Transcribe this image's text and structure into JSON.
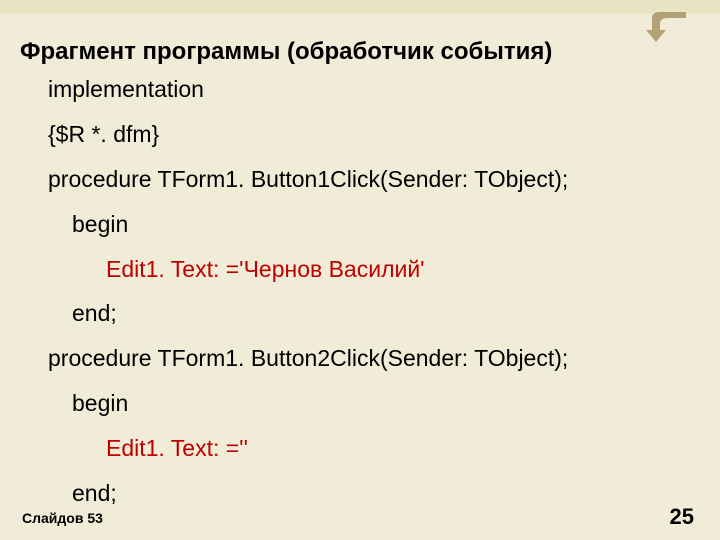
{
  "icon": {
    "name": "return-arrow-icon"
  },
  "title": "Фрагмент программы (обработчик события)",
  "code": {
    "l1": "implementation",
    "l2": "{$R *. dfm}",
    "l3": "procedure TForm1. Button1Click(Sender: TObject);",
    "l4": "begin",
    "l5": "Edit1. Text: ='Чернов Василий'",
    "l6": "end;",
    "l7": "procedure TForm1. Button2Click(Sender: TObject);",
    "l8": "begin",
    "l9": "Edit1. Text: =''",
    "l10": "end;"
  },
  "footer": {
    "left": "Слайдов 53",
    "right": "25"
  }
}
